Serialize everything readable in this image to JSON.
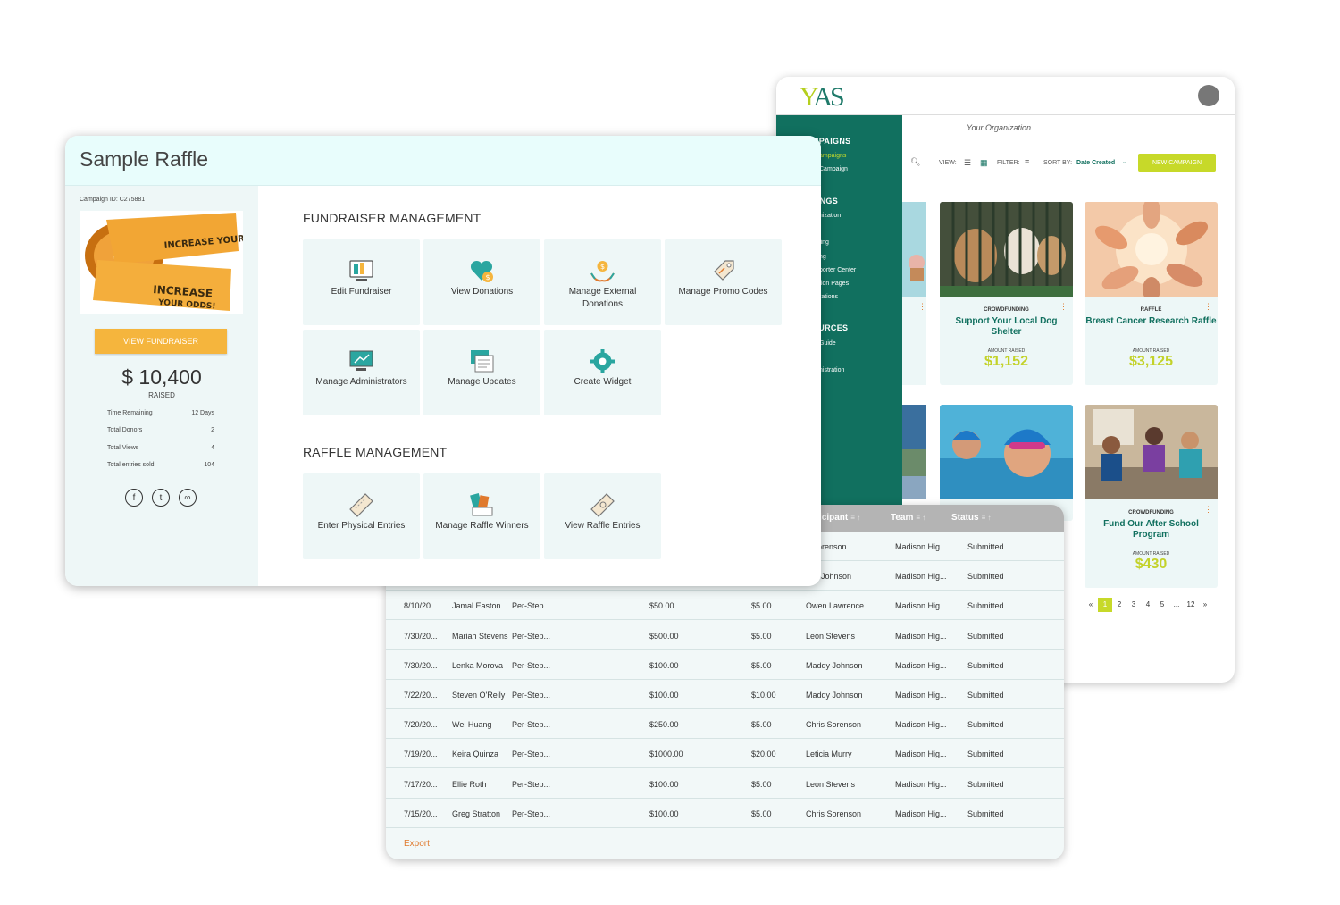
{
  "campaigns_window": {
    "logo": {
      "y": "Y",
      "rest": "AS"
    },
    "org_name": "Your Organization",
    "sidebar": [
      {
        "label": "MPAIGNS",
        "type": "head"
      },
      {
        "label": "ampaigns",
        "type": "active"
      },
      {
        "label": "Campaign",
        "type": "item"
      },
      {
        "label": "TINGS",
        "type": "head"
      },
      {
        "label": "nization",
        "type": "item"
      },
      {
        "label": "ling",
        "type": "item"
      },
      {
        "label": "ng",
        "type": "item"
      },
      {
        "label": "porter Center",
        "type": "item"
      },
      {
        "label": "tion Pages",
        "type": "item"
      },
      {
        "label": "rations",
        "type": "item"
      },
      {
        "label": "OURCES",
        "type": "head"
      },
      {
        "label": "Guide",
        "type": "item"
      },
      {
        "label": "nistration",
        "type": "item"
      }
    ],
    "toolbar": {
      "view_label": "VIEW:",
      "filter_label": "FILTER:",
      "sort_label": "SORT BY:",
      "sort_value": "Date Created",
      "new_campaign": "NEW CAMPAIGN"
    },
    "cards": [
      {
        "type": "CROWDFUNDING",
        "title": "Support Your Local Dog Shelter",
        "raised_label": "AMOUNT RAISED",
        "amount": "$1,152",
        "image": "dogs-in-shelter"
      },
      {
        "type": "RAFFLE",
        "title": "Breast Cancer Research Raffle",
        "raised_label": "AMOUNT RAISED",
        "amount": "$3,125",
        "image": "hands-together"
      },
      {
        "type": "",
        "title": "",
        "raised_label": "",
        "amount": "",
        "image": "kid-swimming"
      },
      {
        "type": "CROWDFUNDING",
        "title": "Fund Our After School Program",
        "raised_label": "AMOUNT RAISED",
        "amount": "$430",
        "image": "students-classroom"
      }
    ],
    "pagination": [
      "«",
      "1",
      "2",
      "3",
      "4",
      "5",
      "...",
      "12",
      "»"
    ],
    "pagination_active": "1"
  },
  "entries_table": {
    "headers": [
      {
        "label": "icipant",
        "icons": "≡ ↑"
      },
      {
        "label": "Team",
        "icons": "≡ ↑"
      },
      {
        "label": "Status",
        "icons": "≡ ↑"
      }
    ],
    "rows": [
      {
        "date": "",
        "donor": "",
        "type": "",
        "amount": "",
        "fee": "",
        "participant": "s Sorenson",
        "team": "Madison Hig...",
        "status": "Submitted"
      },
      {
        "date": "",
        "donor": "",
        "type": "",
        "amount": "",
        "fee": "",
        "participant": "ddy Johnson",
        "team": "Madison Hig...",
        "status": "Submitted"
      },
      {
        "date": "8/10/20...",
        "donor": "Jamal Easton",
        "type": "Per-Step...",
        "amount": "$50.00",
        "fee": "$5.00",
        "participant": "Owen Lawrence",
        "team": "Madison Hig...",
        "status": "Submitted"
      },
      {
        "date": "7/30/20...",
        "donor": "Mariah Stevens",
        "type": "Per-Step...",
        "amount": "$500.00",
        "fee": "$5.00",
        "participant": "Leon Stevens",
        "team": "Madison Hig...",
        "status": "Submitted"
      },
      {
        "date": "7/30/20...",
        "donor": "Lenka Morova",
        "type": "Per-Step...",
        "amount": "$100.00",
        "fee": "$5.00",
        "participant": "Maddy Johnson",
        "team": "Madison Hig...",
        "status": "Submitted"
      },
      {
        "date": "7/22/20...",
        "donor": "Steven O'Reily",
        "type": "Per-Step...",
        "amount": "$100.00",
        "fee": "$10.00",
        "participant": "Maddy Johnson",
        "team": "Madison Hig...",
        "status": "Submitted"
      },
      {
        "date": "7/20/20...",
        "donor": "Wei Huang",
        "type": "Per-Step...",
        "amount": "$250.00",
        "fee": "$5.00",
        "participant": "Chris Sorenson",
        "team": "Madison Hig...",
        "status": "Submitted"
      },
      {
        "date": "7/19/20...",
        "donor": "Keira Quinza",
        "type": "Per-Step...",
        "amount": "$1000.00",
        "fee": "$20.00",
        "participant": "Leticia Murry",
        "team": "Madison Hig...",
        "status": "Submitted"
      },
      {
        "date": "7/17/20...",
        "donor": "Ellie Roth",
        "type": "Per-Step...",
        "amount": "$100.00",
        "fee": "$5.00",
        "participant": "Leon Stevens",
        "team": "Madison Hig...",
        "status": "Submitted"
      },
      {
        "date": "7/15/20...",
        "donor": "Greg Stratton",
        "type": "Per-Step...",
        "amount": "$100.00",
        "fee": "$5.00",
        "participant": "Chris Sorenson",
        "team": "Madison Hig...",
        "status": "Submitted"
      }
    ],
    "export_label": "Export"
  },
  "raffle_window": {
    "title": "Sample Raffle",
    "campaign_id": "Campaign ID: C275881",
    "ticket_text": "INCREASE YOUR ODDS!",
    "view_fundraiser": "VIEW FUNDRAISER",
    "raised_amount": "$ 10,400",
    "raised_label": "RAISED",
    "stats": [
      {
        "label": "Time Remaining",
        "value": "12 Days"
      },
      {
        "label": "Total Donors",
        "value": "2"
      },
      {
        "label": "Total Views",
        "value": "4"
      },
      {
        "label": "Total entries sold",
        "value": "104"
      }
    ],
    "social": [
      "facebook-icon",
      "twitter-icon",
      "link-icon"
    ],
    "fundraiser_title": "FUNDRAISER MANAGEMENT",
    "fundraiser_tiles": [
      {
        "label": "Edit Fundraiser",
        "icon": "edit-fundraiser-icon"
      },
      {
        "label": "View Donations",
        "icon": "view-donations-icon"
      },
      {
        "label": "Manage External Donations",
        "icon": "external-donations-icon"
      },
      {
        "label": "Manage Promo Codes",
        "icon": "promo-codes-icon"
      },
      {
        "label": "Manage Administrators",
        "icon": "administrators-icon"
      },
      {
        "label": "Manage Updates",
        "icon": "updates-icon"
      },
      {
        "label": "Create Widget",
        "icon": "widget-gear-icon"
      }
    ],
    "raffle_title": "RAFFLE MANAGEMENT",
    "raffle_tiles": [
      {
        "label": "Enter Physical Entries",
        "icon": "physical-entries-icon"
      },
      {
        "label": "Manage Raffle Winners",
        "icon": "raffle-winners-icon"
      },
      {
        "label": "View Raffle Entries",
        "icon": "raffle-entries-icon"
      }
    ]
  },
  "colors": {
    "teal": "#11705f",
    "lime": "#c7d929",
    "orange": "#f5b53d",
    "accent_orange": "#e07a2e"
  }
}
